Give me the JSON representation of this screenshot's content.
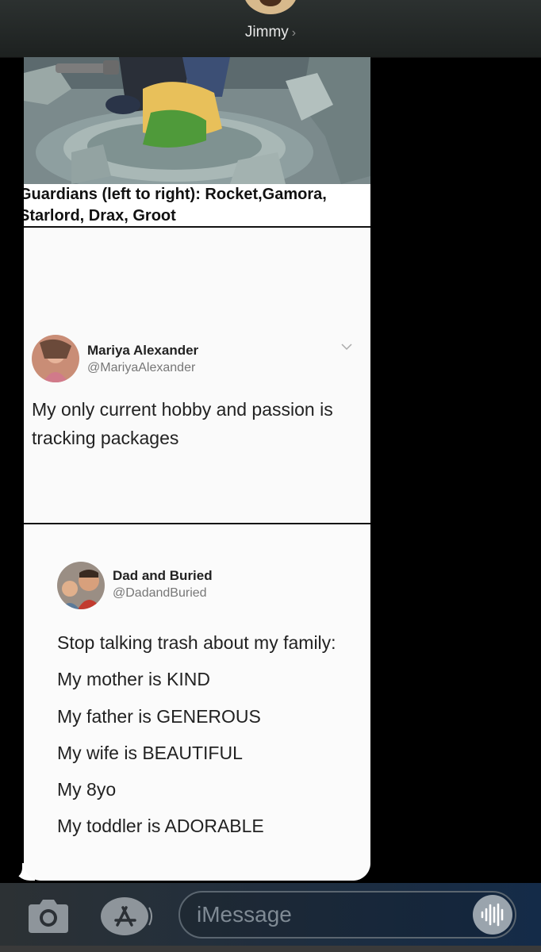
{
  "header": {
    "contact_name": "Jimmy",
    "chevron": "›"
  },
  "message": {
    "image_caption": "Guardians (left to right): Rocket,Gamora, Starlord, Drax, Groot",
    "tweet1": {
      "display_name": "Mariya Alexander",
      "handle": "@MariyaAlexander",
      "text": "My only current hobby and passion is tracking packages"
    },
    "tweet2": {
      "display_name": "Dad and Buried",
      "handle": "@DadandBuried",
      "lines": [
        "Stop talking trash about my family:",
        "My mother is KIND",
        "My father is GENEROUS",
        "My wife is BEAUTIFUL",
        "My 8yo",
        "My toddler is ADORABLE"
      ]
    }
  },
  "composer": {
    "placeholder": "iMessage",
    "icons": [
      "camera-icon",
      "app-store-icon",
      "audio-message-icon"
    ]
  },
  "colors": {
    "bubble": "#ffffff",
    "background": "#000000",
    "header": "#262b2a"
  }
}
